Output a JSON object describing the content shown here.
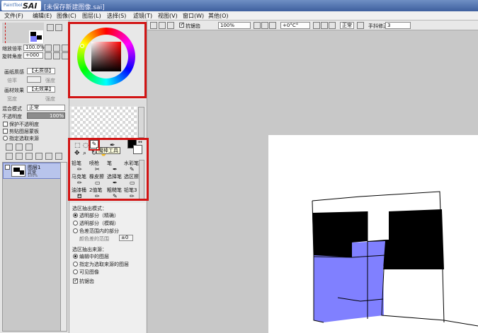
{
  "window": {
    "logo_small": "PaintTool",
    "logo_big": "SAI",
    "doc_title": "[未保存新建图像.sai]"
  },
  "menu": {
    "items": [
      "文件(F)",
      "编辑(E)",
      "图像(C)",
      "图层(L)",
      "选择(S)",
      "滤镜(T)",
      "视图(V)",
      "窗口(W)",
      "其他(O)"
    ]
  },
  "toolbar": {
    "antialias_label": "抗锯齿",
    "zoom_value": "100%",
    "rotation_value": "+0°C°",
    "mode_value": "正常",
    "stabilizer_label": "手抖修正",
    "stabilizer_value": "3"
  },
  "navigator": {
    "zoom_label": "缩放倍率",
    "zoom_value": "100.0%",
    "angle_label": "旋转角度",
    "angle_value": "+000"
  },
  "layer_settings": {
    "paper_texture_label": "画纸质感",
    "paper_texture_value": "【无质感】",
    "scale_label": "倍率",
    "strength_label": "强度",
    "effect_label": "画材效果",
    "effect_value": "【无效果】",
    "width_label": "宽度",
    "blend_mode_label": "混合模式",
    "blend_mode_value": "正常",
    "opacity_label": "不透明度",
    "opacity_value": "100%",
    "protect_alpha_label": "保护不透明度",
    "clip_group_label": "剪贴图层蒙板",
    "selection_source_label": "指定选取来源"
  },
  "layers": [
    {
      "name": "图层1",
      "mode": "正常",
      "opacity": "100%"
    }
  ],
  "tools": {
    "tooltip": "魔棒工具",
    "brushes": [
      {
        "name": "铅笔",
        "icon": "pencil-icon"
      },
      {
        "name": "喷枪",
        "icon": "airbrush-icon"
      },
      {
        "name": "笔",
        "icon": "pen-icon"
      },
      {
        "name": "水彩笔",
        "icon": "watercolor-icon"
      },
      {
        "name": "马克笔",
        "icon": "marker-icon"
      },
      {
        "name": "橡皮擦",
        "icon": "eraser-icon"
      },
      {
        "name": "选择笔",
        "icon": "select-pen-icon"
      },
      {
        "name": "选区擦",
        "icon": "select-eraser-icon"
      },
      {
        "name": "油漆桶",
        "icon": "bucket-icon"
      },
      {
        "name": "2值笔",
        "icon": "binary-pen-icon"
      },
      {
        "name": "粗糙笔",
        "icon": "rough-pen-icon"
      },
      {
        "name": "铅笔3",
        "icon": "pencil-icon"
      }
    ]
  },
  "magic_wand": {
    "range_title": "选区抽出模式：",
    "range_options": [
      "透明部分（精确）",
      "透明部分（模糊）",
      "色差范围内的部分"
    ],
    "range_selected": 0,
    "tolerance_label": "颜色差的范围",
    "tolerance_value": "±0",
    "source_title": "选区抽出来源：",
    "source_options": [
      "编辑中的图层",
      "指定为选取来源的图层",
      "可见图像"
    ],
    "source_selected": 0,
    "antialias_label": "抗锯齿"
  },
  "colors": {
    "primary": "#000000",
    "secondary": "#ffffff",
    "hsv_hue_start": "#ff0000",
    "layer_fill": "#8080ff"
  }
}
